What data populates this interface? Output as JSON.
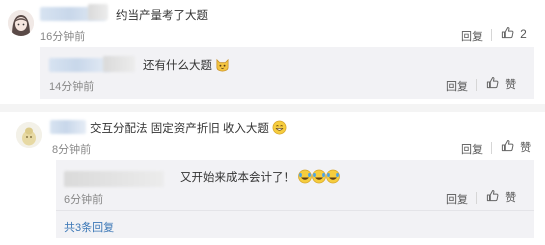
{
  "comments": [
    {
      "text": "约当产量考了大题",
      "time": "16分钟前",
      "reply_label": "回复",
      "like_count": "2",
      "replies": [
        {
          "text": "还有什么大题",
          "time": "14分钟前",
          "reply_label": "回复",
          "like_label": "赞"
        }
      ]
    },
    {
      "text": "交互分配法 固定资产折旧 收入大题",
      "time": "8分钟前",
      "reply_label": "回复",
      "like_label": "赞",
      "replies": [
        {
          "text": "又开始来成本会计了！",
          "time": "6分钟前",
          "reply_label": "回复",
          "like_label": "赞"
        }
      ],
      "more_replies": "共3条回复"
    }
  ],
  "colors": {
    "link": "#3b77b6",
    "reply_bg": "#f2f2f5",
    "separator_band": "#f4f4f4"
  }
}
